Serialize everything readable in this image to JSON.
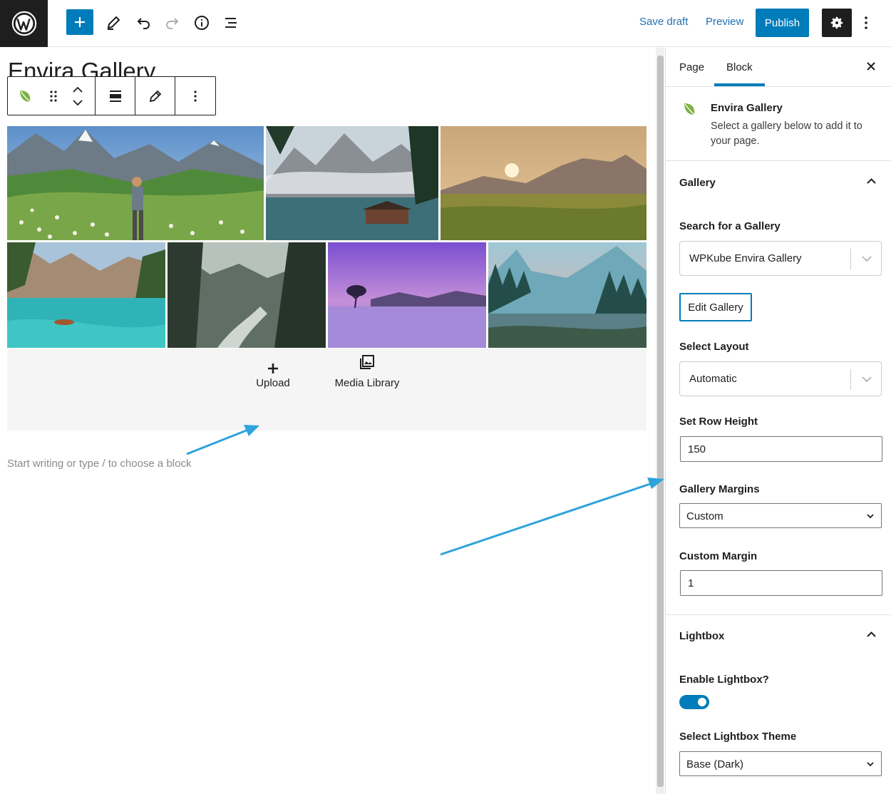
{
  "topbar": {
    "save_draft": "Save draft",
    "preview": "Preview",
    "publish": "Publish"
  },
  "editor": {
    "title": "Envira Gallery",
    "upload_label": "Upload",
    "media_library_label": "Media Library",
    "placeholder": "Start writing or type / to choose a block"
  },
  "sidebar": {
    "tabs": [
      "Page",
      "Block"
    ],
    "active_tab": "Block",
    "block": {
      "name": "Envira Gallery",
      "description": "Select a gallery below to add it to your page."
    },
    "gallery_panel": {
      "title": "Gallery",
      "search_label": "Search for a Gallery",
      "search_value": "WPKube Envira Gallery",
      "edit_button": "Edit Gallery",
      "layout_label": "Select Layout",
      "layout_value": "Automatic",
      "row_height_label": "Set Row Height",
      "row_height_value": "150",
      "margins_label": "Gallery Margins",
      "margins_value": "Custom",
      "custom_margin_label": "Custom Margin",
      "custom_margin_value": "1"
    },
    "lightbox_panel": {
      "title": "Lightbox",
      "enable_label": "Enable Lightbox?",
      "enabled": true,
      "theme_label": "Select Lightbox Theme",
      "theme_value": "Base (Dark)"
    }
  },
  "colors": {
    "accent": "#007cba",
    "dark": "#1e1e1e",
    "annotation_arrow": "#2ea3dc",
    "envira_green": "#7cb342"
  },
  "icons": [
    "wordpress-logo-icon",
    "plus-icon",
    "pencil-icon",
    "undo-icon",
    "redo-icon",
    "info-icon",
    "list-view-icon",
    "gear-icon",
    "more-vertical-icon",
    "close-icon",
    "leaf-icon",
    "drag-handle-icon",
    "chevron-up-icon",
    "chevron-down-icon",
    "align-icon",
    "edit-icon",
    "media-library-icon"
  ]
}
